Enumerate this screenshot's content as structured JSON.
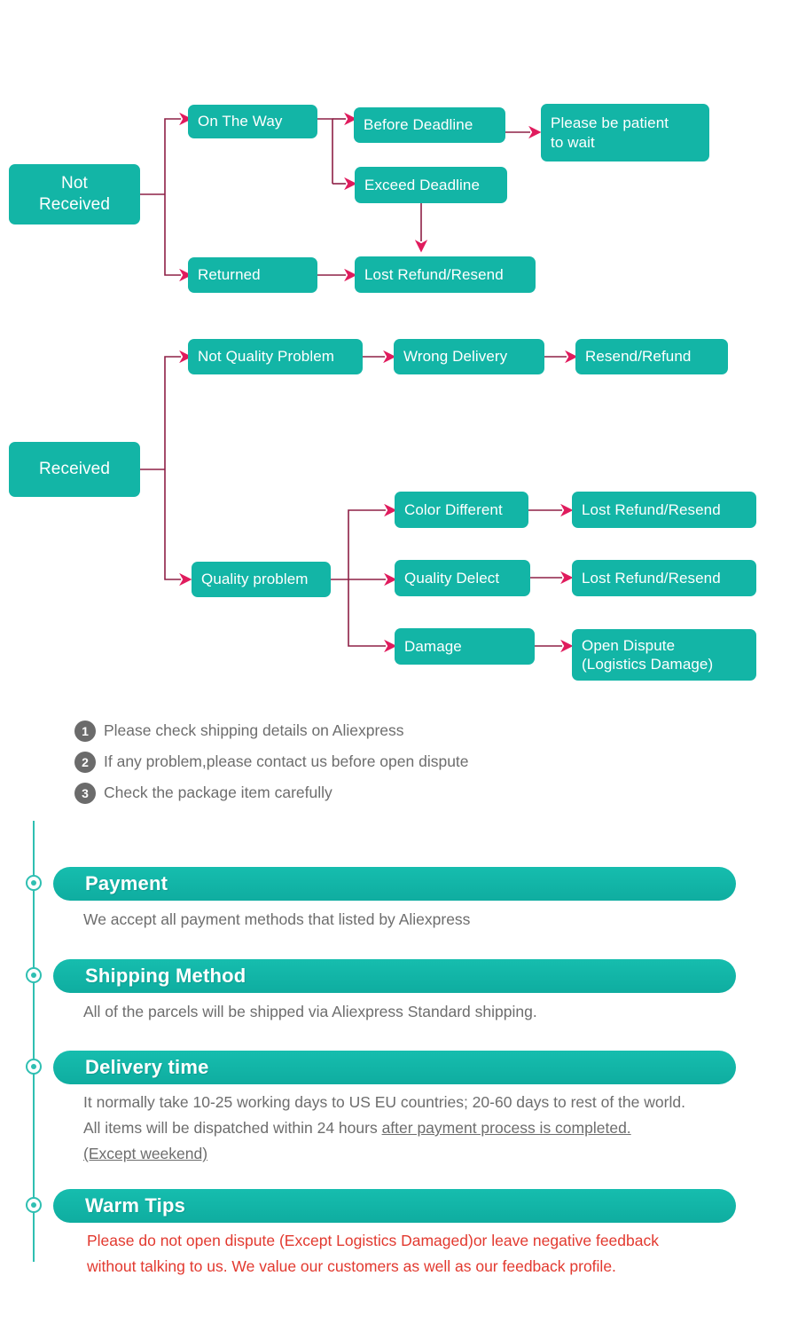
{
  "colors": {
    "node_fill": "#13b5a6",
    "connector_line": "#8e2046",
    "arrow_head": "#e01b5d",
    "note_circle": "#6b6b6b",
    "body_text": "#6d6d6d",
    "timeline": "#2fbfb2",
    "warning_text": "#e2392f"
  },
  "flowchart": {
    "title": "Not Received / Received dispute flow",
    "branches": [
      {
        "root": "Not\nReceived",
        "paths": [
          [
            "On The Way",
            "Before Deadline",
            "Please be patient\nto wait"
          ],
          [
            "On The Way",
            "Exceed Deadline",
            "Lost Refund/Resend"
          ],
          [
            "Returned",
            "Lost Refund/Resend"
          ]
        ]
      },
      {
        "root": "Received",
        "paths": [
          [
            "Not Quality Problem",
            "Wrong Delivery",
            "Resend/Refund"
          ],
          [
            "Quality problem",
            "Color Different",
            "Lost Refund/Resend"
          ],
          [
            "Quality problem",
            "Quality Delect",
            "Lost Refund/Resend"
          ],
          [
            "Quality problem",
            "Damage",
            "Open Dispute\n(Logistics Damage)"
          ]
        ]
      }
    ],
    "nodes": {
      "not_received": "Not\nReceived",
      "on_the_way": "On The Way",
      "before_deadline": "Before Deadline",
      "please_be_patient": "Please be patient\nto wait",
      "exceed_deadline": "Exceed Deadline",
      "returned": "Returned",
      "lost_refund_resend_1": "Lost Refund/Resend",
      "received": "Received",
      "not_quality_problem": "Not Quality Problem",
      "wrong_delivery": "Wrong Delivery",
      "resend_refund": "Resend/Refund",
      "quality_problem": "Quality problem",
      "color_different": "Color Different",
      "lost_refund_resend_2": "Lost Refund/Resend",
      "quality_delect": "Quality Delect",
      "lost_refund_resend_3": "Lost Refund/Resend",
      "damage": "Damage",
      "open_dispute": "Open Dispute\n(Logistics Damage)"
    }
  },
  "notes": [
    {
      "num": "1",
      "text": "Please check shipping details on Aliexpress"
    },
    {
      "num": "2",
      "text": "If any problem,please contact us before open dispute"
    },
    {
      "num": "3",
      "text": "Check the package item carefully"
    }
  ],
  "sections": {
    "payment": {
      "heading": "Payment",
      "body": "We accept all payment methods that listed by Aliexpress"
    },
    "shipping_method": {
      "heading": "Shipping Method",
      "body": "All of the parcels will be shipped via Aliexpress Standard shipping."
    },
    "delivery_time": {
      "heading": "Delivery time",
      "body_line1": "It normally take 10-25 working days to US EU countries; 20-60 days to rest of the world.",
      "body_line2_plain": "All items will be dispatched within 24 hours ",
      "body_line2_underlined": "after payment process is completed.",
      "body_line3_underlined": "(Except weekend)"
    },
    "warm_tips": {
      "heading": "Warm Tips",
      "body_line1": "Please do not open dispute (Except Logistics Damaged)or leave negative feedback",
      "body_line2": "without talking to us. We value our customers as well as our feedback profile."
    }
  }
}
